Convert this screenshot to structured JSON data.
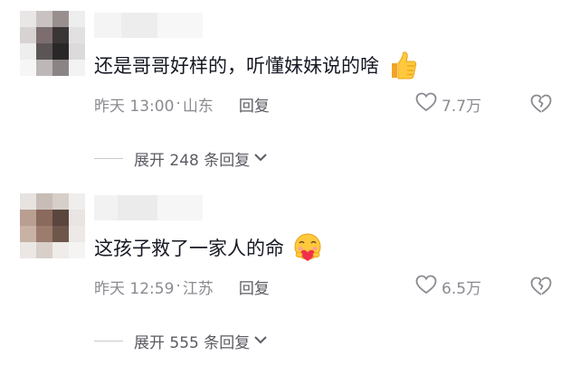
{
  "comments": [
    {
      "text": "还是哥哥好样的，听懂妹妹说的啥",
      "emoji": "thumbs-up-emoji",
      "time": "昨天 13:00",
      "separator": "·",
      "location": "山东",
      "reply_label": "回复",
      "likes": "7.7万",
      "expand_label": "展开 248 条回复",
      "avatar_colors": [
        "#e9e6e6",
        "#c9c2c2",
        "#9a8f8f",
        "#eeeeee",
        "#d8d3d3",
        "#7c6e6f",
        "#3b3636",
        "#e2e0e1",
        "#efeeee",
        "#5c5556",
        "#2a2728",
        "#dcdadb",
        "#f6f6f6",
        "#bdb7b8",
        "#8b8485",
        "#f3f3f3"
      ]
    },
    {
      "text": "这孩子救了一家人的命",
      "emoji": "smiling-face-with-heart-emoji",
      "time": "昨天 12:59",
      "separator": "·",
      "location": "江苏",
      "reply_label": "回复",
      "likes": "6.5万",
      "expand_label": "展开 555 条回复",
      "avatar_colors": [
        "#e7e3e1",
        "#c7bdb6",
        "#d6cfc9",
        "#f0eeed",
        "#b89f92",
        "#8a6a5c",
        "#5a463e",
        "#e9e5e3",
        "#c8b2a6",
        "#9c7c6d",
        "#6e564b",
        "#ece9e7",
        "#ebe7e5",
        "#d9cfc9",
        "#efecea",
        "#f5f4f3"
      ]
    }
  ],
  "colors": {
    "text_primary": "#161823",
    "text_secondary": "#8a8b91",
    "emoji_yellow": "#ffc83d",
    "heart_red": "#f0304d"
  }
}
